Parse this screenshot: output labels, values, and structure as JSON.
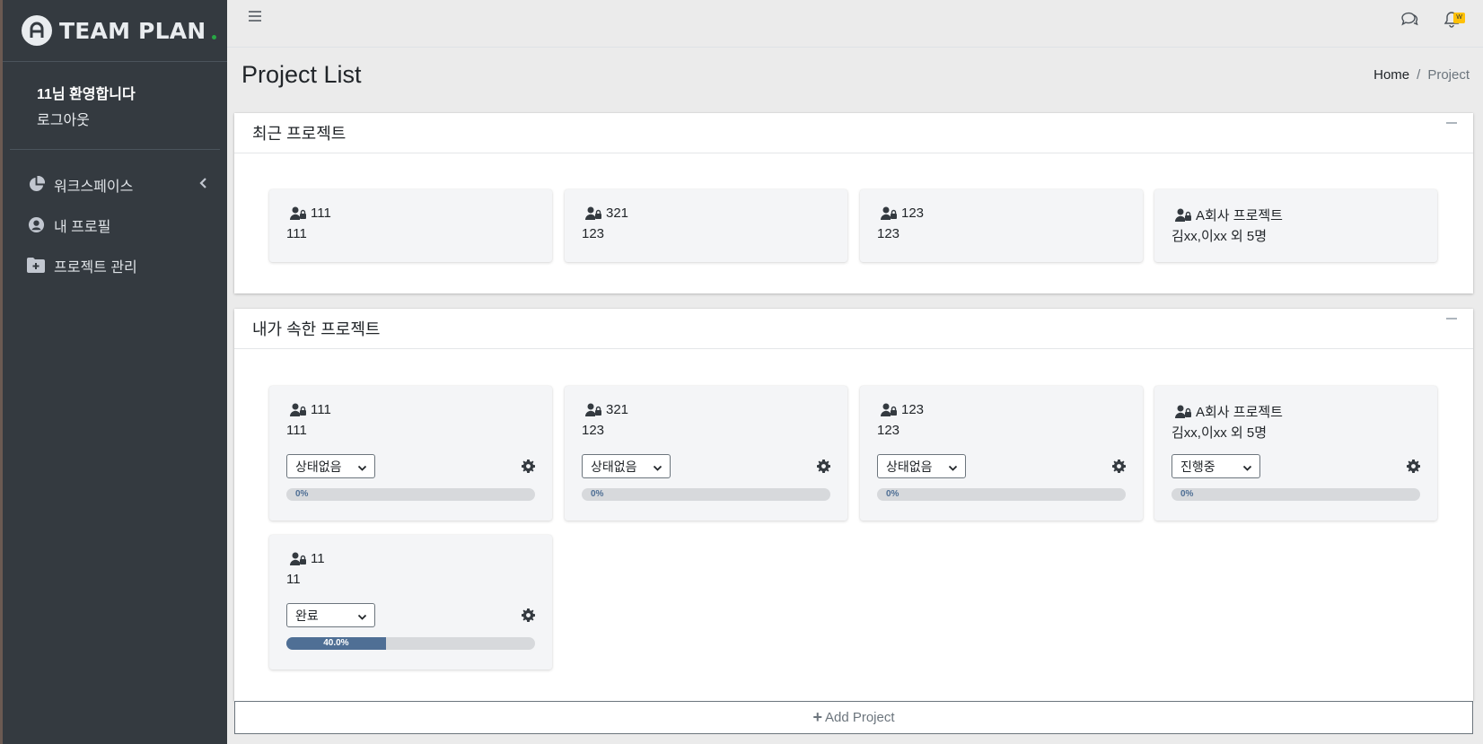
{
  "brand": {
    "name": "TEAM PLAN"
  },
  "sidebar": {
    "user_greeting": "11님 환영합니다",
    "logout_label": "로그아웃",
    "items": [
      {
        "label": "워크스페이스",
        "icon": "pie-chart-icon"
      },
      {
        "label": "내 프로필",
        "icon": "user-circle-icon"
      },
      {
        "label": "프로젝트 관리",
        "icon": "folder-plus-icon"
      }
    ]
  },
  "topbar": {
    "notification_badge": "W"
  },
  "page": {
    "title": "Project List",
    "breadcrumb": {
      "home": "Home",
      "separator": "/",
      "current": "Project"
    }
  },
  "recent": {
    "title": "최근 프로젝트",
    "projects": [
      {
        "name": "111",
        "desc": "111"
      },
      {
        "name": "321",
        "desc": "123"
      },
      {
        "name": "123",
        "desc": "123"
      },
      {
        "name": "A회사 프로젝트",
        "desc": "김xx,이xx 외 5명"
      }
    ]
  },
  "mine": {
    "title": "내가 속한 프로젝트",
    "projects": [
      {
        "name": "111",
        "desc": "111",
        "status": "상태없음",
        "progress_label": "0%",
        "progress": 0
      },
      {
        "name": "321",
        "desc": "123",
        "status": "상태없음",
        "progress_label": "0%",
        "progress": 0
      },
      {
        "name": "123",
        "desc": "123",
        "status": "상태없음",
        "progress_label": "0%",
        "progress": 0
      },
      {
        "name": "A회사 프로젝트",
        "desc": "김xx,이xx 외 5명",
        "status": "진행중",
        "progress_label": "0%",
        "progress": 0
      },
      {
        "name": "11",
        "desc": "11",
        "status": "완료",
        "progress_label": "40.0%",
        "progress": 40
      }
    ]
  },
  "actions": {
    "add_project": "Add Project"
  },
  "colors": {
    "sidebar_bg": "#343a40",
    "progress_fill": "#4f6f95",
    "badge": "#ffc107",
    "brand_dot": "#28a745"
  }
}
